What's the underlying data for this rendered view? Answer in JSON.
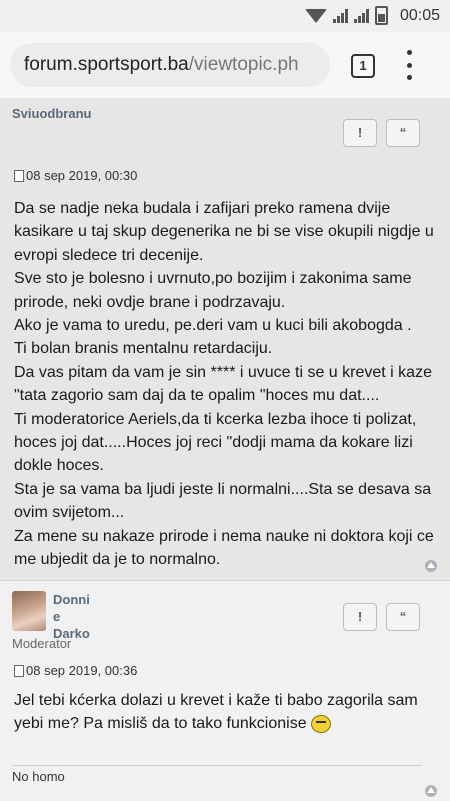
{
  "status_bar": {
    "time": "00:05"
  },
  "browser": {
    "url_domain": "forum.sportsport.ba",
    "url_path": "/viewtopic.ph",
    "tab_count": "1"
  },
  "posts": [
    {
      "author": "Sviuodbranu",
      "report_label": "!",
      "quote_label": "“",
      "date": "08 sep 2019, 00:30",
      "lines": [
        "Da se nadje neka budala i zafijari preko ramena dvije",
        "kasikare u taj skup degenerika ne bi se vise okupili nigdje u",
        "evropi sledece tri decenije.",
        "Sve sto je bolesno i uvrnuto,po bozijim i zakonima same",
        "prirode, neki ovdje brane i podrzavaju.",
        "Ako je vama to uredu, pe.deri vam u kuci bili akobogda .",
        "Ti bolan branis mentalnu retardaciju.",
        "Da vas pitam da vam je sin **** i uvuce ti se u krevet i kaze",
        "\"tata zagorio sam daj da te opalim \"hoces mu dat....",
        "Ti moderatorice Aeriels,da ti kcerka lezba ihoce ti polizat,",
        "hoces joj dat.....Hoces joj reci \"dodji mama da kokare lizi",
        "dokle hoces.",
        "Sta je sa vama ba ljudi jeste li normalni....Sta se desava sa",
        "ovim svijetom...",
        "Za mene su nakaze prirode i nema nauke ni doktora koji ce",
        "me ubjedit da je to normalno."
      ]
    },
    {
      "author_line1": "Donni",
      "author_line2": "e",
      "author_line3": "Darko",
      "rank": "Moderator",
      "report_label": "!",
      "quote_label": "“",
      "date": "08 sep 2019, 00:36",
      "lines": [
        "Jel tebi kćerka dolazi u krevet i kaže ti babo zagorila sam",
        "yebi me? Pa misliš da to tako funkcionise"
      ],
      "signature": "No homo"
    }
  ],
  "icons": {
    "report": "exclamation-icon",
    "quote": "quote-icon",
    "post_time": "document-icon",
    "back_to_top": "arrow-up-icon",
    "emoji": "laughing-smiley-icon"
  }
}
